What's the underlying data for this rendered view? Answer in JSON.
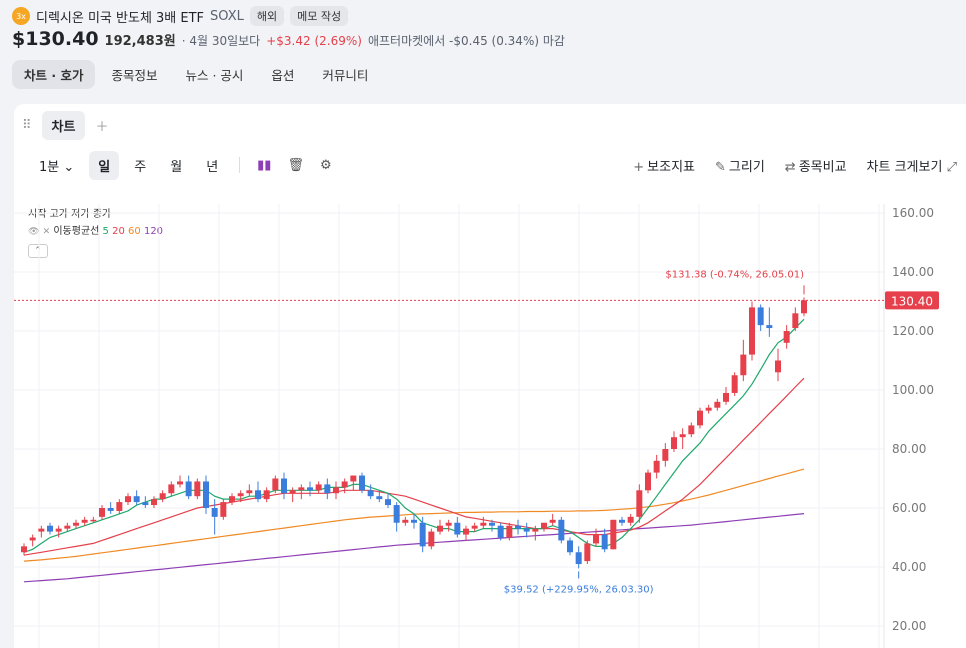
{
  "header": {
    "logo_text": "3x",
    "name": "디렉시온 미국 반도체 3배 ETF",
    "ticker": "SOXL",
    "badge_overseas": "해외",
    "memo_button": "메모 작성",
    "price": "$130.40",
    "price_krw": "192,483원",
    "date_note": "· 4월 30일보다",
    "change": "+$3.42 (2.69%)",
    "after_market": "애프터마켓에서 -$0.45 (0.34%) 마감"
  },
  "tabs": [
    {
      "label": "차트 · 호가",
      "active": true
    },
    {
      "label": "종목정보",
      "active": false
    },
    {
      "label": "뉴스 · 공시",
      "active": false
    },
    {
      "label": "옵션",
      "active": false
    },
    {
      "label": "커뮤니티",
      "active": false
    }
  ],
  "chart_tab": {
    "label": "차트"
  },
  "toolbar": {
    "interval": "1분",
    "periods": [
      {
        "label": "일",
        "active": true
      },
      {
        "label": "주",
        "active": false
      },
      {
        "label": "월",
        "active": false
      },
      {
        "label": "년",
        "active": false
      }
    ],
    "indicator": "보조지표",
    "draw": "그리기",
    "compare": "종목비교",
    "expand": "차트 크게보기"
  },
  "legend": {
    "ohlc": "시작 고가 저가 종가",
    "ma_label": "이동평균선",
    "ma5": "5",
    "ma20": "20",
    "ma60": "60",
    "ma120": "120"
  },
  "colors": {
    "up": "#e5404b",
    "down": "#3b7ddd",
    "ma5": "#1ea86b",
    "ma20": "#e5404b",
    "ma60": "#f08a24",
    "ma120": "#8e3fb5"
  },
  "chart_data": {
    "type": "candlestick",
    "y_ticks": [
      "160.00",
      "140.00",
      "120.00",
      "100.00",
      "80.00",
      "60.00",
      "40.00",
      "20.00"
    ],
    "ylim": [
      20,
      160
    ],
    "current_price_label": "130.40",
    "current_price": 130.4,
    "high_annotation": {
      "text": "$131.38 (-0.74%, 26.05.01)",
      "value": 131.38
    },
    "low_annotation": {
      "text": "$39.52 (+229.95%, 26.03.30)",
      "value": 39.52
    },
    "candles": [
      [
        45,
        48,
        44,
        47
      ],
      [
        49,
        51,
        47,
        50
      ],
      [
        52,
        54,
        50,
        53
      ],
      [
        54,
        55,
        51,
        52
      ],
      [
        52,
        54,
        50,
        53
      ],
      [
        53,
        55,
        52,
        54
      ],
      [
        54,
        56,
        53,
        55
      ],
      [
        55,
        57,
        54,
        56
      ],
      [
        56,
        57,
        55,
        56
      ],
      [
        57,
        61,
        56,
        60
      ],
      [
        60,
        62,
        58,
        59
      ],
      [
        59,
        63,
        58,
        62
      ],
      [
        62,
        65,
        61,
        64
      ],
      [
        64,
        66,
        61,
        62
      ],
      [
        62,
        64,
        60,
        61
      ],
      [
        61,
        64,
        60,
        63
      ],
      [
        63,
        66,
        62,
        65
      ],
      [
        65,
        69,
        64,
        68
      ],
      [
        68,
        71,
        67,
        69
      ],
      [
        69,
        71,
        63,
        64
      ],
      [
        64,
        70,
        63,
        69
      ],
      [
        69,
        71,
        58,
        60
      ],
      [
        60,
        63,
        51,
        57
      ],
      [
        57,
        63,
        56,
        62
      ],
      [
        62,
        65,
        61,
        64
      ],
      [
        64,
        66,
        62,
        65
      ],
      [
        65,
        68,
        64,
        66
      ],
      [
        66,
        69,
        62,
        63
      ],
      [
        63,
        67,
        62,
        66
      ],
      [
        66,
        71,
        65,
        70
      ],
      [
        70,
        72,
        63,
        65
      ],
      [
        65,
        67,
        62,
        66
      ],
      [
        66,
        68,
        63,
        67
      ],
      [
        67,
        69,
        64,
        66
      ],
      [
        66,
        69,
        65,
        68
      ],
      [
        68,
        70,
        63,
        65
      ],
      [
        65,
        69,
        63,
        67
      ],
      [
        67,
        70,
        65,
        69
      ],
      [
        69,
        71,
        66,
        71
      ],
      [
        71,
        72,
        65,
        66
      ],
      [
        66,
        68,
        63,
        64
      ],
      [
        64,
        66,
        62,
        63
      ],
      [
        63,
        65,
        60,
        61
      ],
      [
        61,
        62,
        52,
        55
      ],
      [
        55,
        57,
        54,
        56
      ],
      [
        56,
        58,
        53,
        55
      ],
      [
        55,
        57,
        45,
        47
      ],
      [
        47,
        53,
        46,
        52
      ],
      [
        52,
        56,
        51,
        54
      ],
      [
        54,
        56,
        52,
        55
      ],
      [
        55,
        57,
        50,
        51
      ],
      [
        51,
        54,
        49,
        53
      ],
      [
        53,
        55,
        52,
        54
      ],
      [
        54,
        57,
        53,
        55
      ],
      [
        55,
        56,
        52,
        54
      ],
      [
        54,
        55,
        49,
        50
      ],
      [
        50,
        55,
        49,
        54
      ],
      [
        54,
        56,
        51,
        53
      ],
      [
        53,
        55,
        50,
        52
      ],
      [
        52,
        54,
        49,
        53
      ],
      [
        53,
        55,
        52,
        55
      ],
      [
        55,
        58,
        54,
        56
      ],
      [
        56,
        57,
        48,
        49
      ],
      [
        49,
        50,
        44,
        45
      ],
      [
        45,
        47,
        39.52,
        41
      ],
      [
        42,
        49,
        41,
        48
      ],
      [
        48,
        53,
        47,
        51
      ],
      [
        51,
        53,
        45,
        46
      ],
      [
        46,
        56,
        46,
        56
      ],
      [
        56,
        57,
        54,
        55
      ],
      [
        55,
        58,
        54,
        57
      ],
      [
        57,
        68,
        55,
        66
      ],
      [
        66,
        73,
        65,
        72
      ],
      [
        72,
        78,
        70,
        76
      ],
      [
        76,
        82,
        74,
        80
      ],
      [
        80,
        86,
        79,
        84
      ],
      [
        84,
        87,
        80,
        85
      ],
      [
        85,
        89,
        84,
        88
      ],
      [
        88,
        94,
        87,
        93
      ],
      [
        93,
        95,
        92,
        94
      ],
      [
        94,
        97,
        93,
        96
      ],
      [
        96,
        101,
        95,
        99
      ],
      [
        99,
        106,
        98,
        105
      ],
      [
        105,
        117,
        103,
        112
      ],
      [
        112,
        130,
        110,
        128
      ],
      [
        128,
        129,
        120,
        122
      ],
      [
        122,
        128,
        118,
        121
      ],
      [
        106,
        114,
        103,
        110
      ],
      [
        116,
        122,
        114,
        120
      ],
      [
        121,
        128,
        120,
        126
      ],
      [
        126,
        131.38,
        125,
        130.4
      ]
    ],
    "ma5": [
      45,
      46,
      48,
      50,
      51,
      52,
      53,
      54,
      55,
      56,
      57,
      58,
      59,
      61,
      62,
      63,
      63,
      64,
      65,
      66,
      66,
      66,
      64,
      63,
      63,
      63,
      64,
      64,
      65,
      66,
      66,
      66,
      66,
      66,
      66,
      67,
      67,
      67,
      68,
      68,
      67,
      66,
      65,
      63,
      60,
      58,
      55,
      54,
      53,
      53,
      52,
      52,
      52,
      53,
      53,
      53,
      53,
      53,
      53,
      53,
      53,
      54,
      53,
      52,
      50,
      48,
      47,
      47,
      48,
      50,
      53,
      56,
      60,
      64,
      68,
      72,
      76,
      79,
      82,
      86,
      89,
      92,
      95,
      98,
      102,
      107,
      112,
      116,
      118,
      121,
      124
    ],
    "ma20": [
      44,
      44.5,
      45,
      45.5,
      46,
      46.5,
      47,
      47.5,
      48,
      49,
      50,
      51,
      52,
      53,
      54,
      55,
      56,
      57,
      58,
      59,
      60,
      60.5,
      61,
      61.5,
      62,
      62.5,
      63,
      63.5,
      64,
      64.5,
      65,
      65,
      65,
      65,
      65,
      65,
      65.5,
      66,
      66,
      66,
      66,
      65.5,
      65,
      64.5,
      64,
      63,
      62,
      61,
      60,
      59,
      58,
      57,
      56.5,
      56,
      55.5,
      55,
      54.5,
      54,
      53.5,
      53,
      53,
      53,
      52.5,
      52,
      51.5,
      51,
      51,
      51,
      51.5,
      52,
      52.5,
      53.5,
      55,
      57,
      59,
      61,
      63,
      65.5,
      68,
      71,
      74,
      77,
      80,
      83,
      86,
      89,
      92,
      95,
      98,
      101,
      104
    ],
    "ma60": [
      42,
      42.2,
      42.4,
      42.7,
      43,
      43.3,
      43.6,
      44,
      44.4,
      44.8,
      45.2,
      45.6,
      46,
      46.4,
      46.8,
      47.2,
      47.6,
      48,
      48.4,
      48.8,
      49.2,
      49.6,
      50,
      50.4,
      50.8,
      51.2,
      51.6,
      52,
      52.4,
      52.8,
      53.2,
      53.6,
      54,
      54.4,
      54.8,
      55.2,
      55.6,
      56,
      56.3,
      56.6,
      56.9,
      57.1,
      57.3,
      57.5,
      57.7,
      57.9,
      58,
      58.1,
      58.2,
      58.3,
      58.4,
      58.5,
      58.5,
      58.6,
      58.6,
      58.7,
      58.7,
      58.7,
      58.8,
      58.8,
      58.8,
      58.9,
      58.9,
      58.9,
      59,
      59,
      59.1,
      59.2,
      59.4,
      59.6,
      59.8,
      60.1,
      60.4,
      60.8,
      61.3,
      61.8,
      62.4,
      63,
      63.7,
      64.4,
      65.2,
      66,
      66.8,
      67.6,
      68.4,
      69.2,
      70,
      70.8,
      71.6,
      72.4,
      73.2
    ],
    "ma120": [
      35,
      35.2,
      35.4,
      35.6,
      35.8,
      36,
      36.3,
      36.6,
      36.9,
      37.2,
      37.5,
      37.8,
      38.1,
      38.4,
      38.7,
      39,
      39.3,
      39.6,
      39.9,
      40.2,
      40.5,
      40.8,
      41.1,
      41.4,
      41.7,
      42,
      42.3,
      42.6,
      42.9,
      43.2,
      43.5,
      43.8,
      44.1,
      44.4,
      44.7,
      45,
      45.3,
      45.6,
      45.9,
      46.2,
      46.5,
      46.8,
      47.1,
      47.4,
      47.6,
      47.8,
      48,
      48.2,
      48.4,
      48.6,
      48.8,
      49,
      49.2,
      49.4,
      49.6,
      49.8,
      50,
      50.2,
      50.4,
      50.6,
      50.8,
      51,
      51.2,
      51.4,
      51.6,
      51.8,
      52,
      52.2,
      52.4,
      52.6,
      52.8,
      53,
      53.2,
      53.4,
      53.6,
      53.8,
      54,
      54.2,
      54.5,
      54.8,
      55.1,
      55.4,
      55.7,
      56,
      56.3,
      56.6,
      56.9,
      57.2,
      57.5,
      57.8,
      58.1
    ]
  }
}
